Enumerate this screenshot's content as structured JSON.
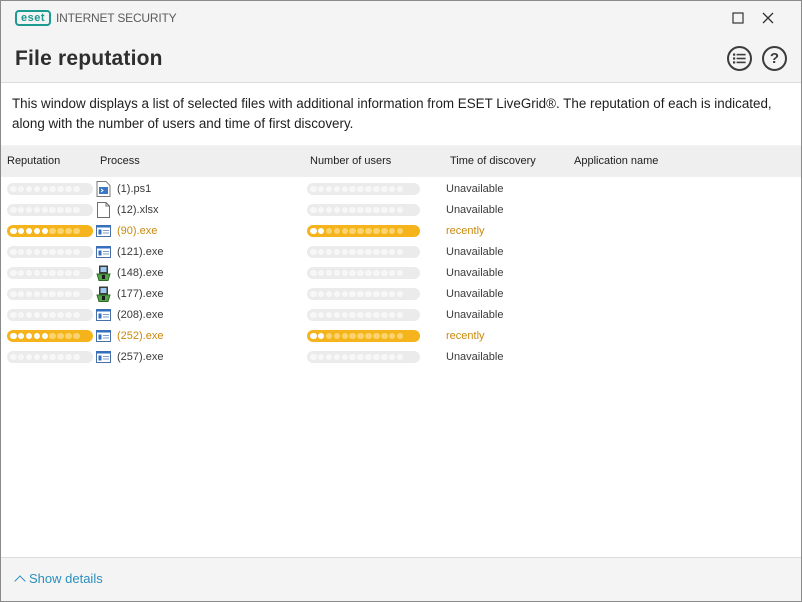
{
  "app": {
    "brand": "eset",
    "product": "INTERNET SECURITY"
  },
  "window": {
    "minimize_icon": "square-icon",
    "close_icon": "close-icon"
  },
  "header": {
    "title": "File reputation",
    "list_icon": "list-icon",
    "help_label": "?"
  },
  "description": "This window displays a list of selected files with additional information from ESET LiveGrid®. The reputation of each is indicated, along with the number of users and time of first discovery.",
  "table": {
    "columns": [
      "Reputation",
      "Process",
      "Number of users",
      "Time of discovery",
      "Application name"
    ],
    "rows": [
      {
        "reputation": 0,
        "icon": "powershell-file-icon",
        "process": "(1).ps1",
        "users": 0,
        "time": "Unavailable",
        "application": ""
      },
      {
        "reputation": 0,
        "icon": "blank-file-icon",
        "process": "(12).xlsx",
        "users": 0,
        "time": "Unavailable",
        "application": ""
      },
      {
        "reputation": 5,
        "icon": "executable-icon",
        "process": "(90).exe",
        "users": 2,
        "time": "recently",
        "application": ""
      },
      {
        "reputation": 0,
        "icon": "executable-icon",
        "process": "(121).exe",
        "users": 0,
        "time": "Unavailable",
        "application": ""
      },
      {
        "reputation": 0,
        "icon": "installer-icon",
        "process": "(148).exe",
        "users": 0,
        "time": "Unavailable",
        "application": ""
      },
      {
        "reputation": 0,
        "icon": "installer-icon",
        "process": "(177).exe",
        "users": 0,
        "time": "Unavailable",
        "application": ""
      },
      {
        "reputation": 0,
        "icon": "executable-icon",
        "process": "(208).exe",
        "users": 0,
        "time": "Unavailable",
        "application": ""
      },
      {
        "reputation": 5,
        "icon": "executable-icon",
        "process": "(252).exe",
        "users": 2,
        "time": "recently",
        "application": ""
      },
      {
        "reputation": 0,
        "icon": "executable-icon",
        "process": "(257).exe",
        "users": 0,
        "time": "Unavailable",
        "application": ""
      }
    ]
  },
  "footer": {
    "show_details": "Show details"
  },
  "colors": {
    "accent": "#f5b41b",
    "highlight_text": "#c98a0c",
    "link": "#2b8fbd",
    "brand": "#1d9a92"
  }
}
